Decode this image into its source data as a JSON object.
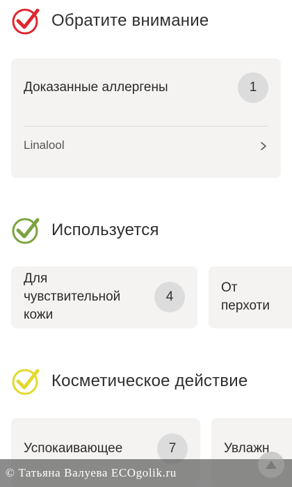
{
  "sections": {
    "attention": {
      "title": "Обратите внимание",
      "card": {
        "label": "Доказанные аллергены",
        "count": "1",
        "items": [
          "Linalool"
        ]
      }
    },
    "used": {
      "title": "Используется",
      "cards": [
        {
          "label_lines": [
            "Для",
            "чувствительной",
            "кожи"
          ],
          "count": "4"
        },
        {
          "label_lines": [
            "От",
            "перхоти"
          ]
        }
      ]
    },
    "cosmetic": {
      "title": "Косметическое действие",
      "cards": [
        {
          "label": "Успокаивающее",
          "count": "7"
        },
        {
          "label": "Увлажн"
        }
      ]
    }
  },
  "footer": {
    "watermark": "© Татьяна Валуева ECOgolik.ru"
  },
  "colors": {
    "check_red": "#e0262f",
    "check_green": "#7aa33d",
    "check_yellow": "#e2d92e",
    "card_bg": "#f4f3f1",
    "badge_bg": "#dcdcdc"
  },
  "icons": {
    "attention": "check-circle-red-icon",
    "used": "check-circle-green-icon",
    "cosmetic": "check-circle-yellow-icon",
    "row": "chevron-right-icon",
    "scroll": "arrow-up-icon"
  }
}
